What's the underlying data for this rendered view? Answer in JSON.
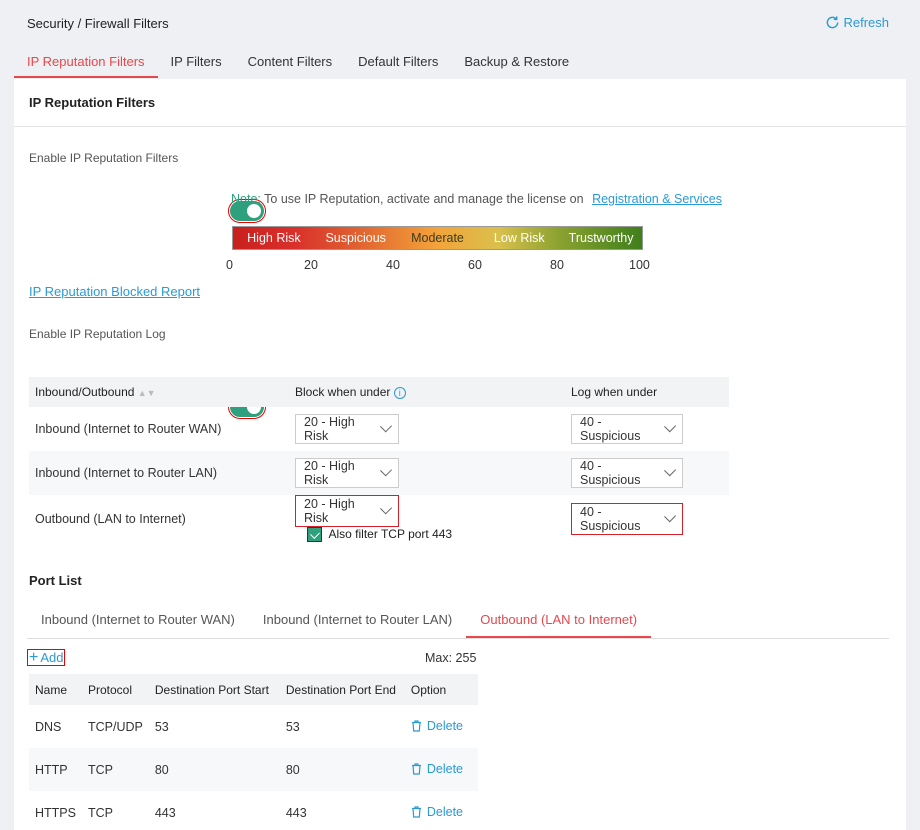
{
  "breadcrumb": "Security / Firewall Filters",
  "refresh_label": "Refresh",
  "tabs": [
    "IP Reputation Filters",
    "IP Filters",
    "Content Filters",
    "Default Filters",
    "Backup & Restore"
  ],
  "panel_title": "IP Reputation Filters",
  "enable_filters_label": "Enable IP Reputation Filters",
  "enable_filters_on": true,
  "note_prefix": "Note:",
  "note_text": "To use IP Reputation, activate and manage the license on",
  "note_link": "Registration & Services",
  "risk_levels": [
    "High Risk",
    "Suspicious",
    "Moderate",
    "Low Risk",
    "Trustworthy"
  ],
  "risk_ticks": [
    "0",
    "20",
    "40",
    "60",
    "80",
    "100"
  ],
  "blocked_report_link": "IP Reputation Blocked Report",
  "enable_log_label": "Enable IP Reputation Log",
  "enable_log_on": true,
  "rep_table": {
    "headers": [
      "Inbound/Outbound",
      "Block when under",
      "Log when under"
    ],
    "rows": [
      {
        "direction": "Inbound (Internet to Router WAN)",
        "block": "20 - High Risk",
        "log": "40 - Suspicious"
      },
      {
        "direction": "Inbound (Internet to Router LAN)",
        "block": "20 - High Risk",
        "log": "40 - Suspicious"
      },
      {
        "direction": "Outbound (LAN to Internet)",
        "block": "20 - High Risk",
        "log": "40 - Suspicious"
      }
    ],
    "tcp_filter_label": "Also filter TCP port 443"
  },
  "port_list": {
    "title": "Port List",
    "tabs": [
      "Inbound (Internet to Router WAN)",
      "Inbound (Internet to Router LAN)",
      "Outbound (LAN to Internet)"
    ],
    "add_label": "Add",
    "max_label": "Max: 255",
    "headers": [
      "Name",
      "Protocol",
      "Destination Port Start",
      "Destination Port End",
      "Option"
    ],
    "rows": [
      {
        "name": "DNS",
        "protocol": "TCP/UDP",
        "start": "53",
        "end": "53",
        "option": "Delete"
      },
      {
        "name": "HTTP",
        "protocol": "TCP",
        "start": "80",
        "end": "80",
        "option": "Delete"
      },
      {
        "name": "HTTPS",
        "protocol": "TCP",
        "start": "443",
        "end": "443",
        "option": "Delete"
      }
    ]
  },
  "colors": {
    "accent": "#e8474c",
    "link": "#2a9ad6",
    "toggle": "#2ea07e"
  }
}
